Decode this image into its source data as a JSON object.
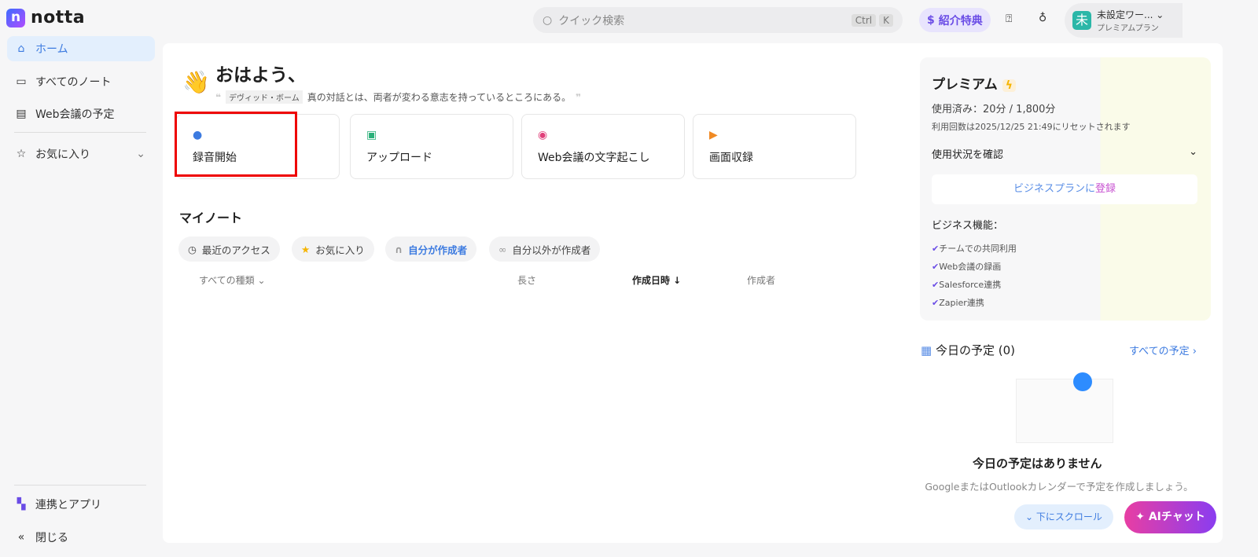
{
  "app": {
    "logo_letter": "n",
    "name": "notta"
  },
  "sidebar": {
    "items": [
      {
        "label": "ホーム",
        "icon": "home-icon"
      },
      {
        "label": "すべてのノート",
        "icon": "folder-icon"
      },
      {
        "label": "Web会議の予定",
        "icon": "calendar-icon"
      },
      {
        "label": "お気に入り",
        "icon": "star-icon"
      }
    ],
    "bottom": [
      {
        "label": "連携とアプリ"
      },
      {
        "label": "閉じる"
      }
    ]
  },
  "header": {
    "search_placeholder": "クイック検索",
    "kbd1": "Ctrl",
    "kbd2": "K",
    "referral": "紹介特典",
    "user_name": "未設定ワー...",
    "user_avatar": "未",
    "user_plan": "プレミアムプラン"
  },
  "greeting": {
    "title": "おはよう、",
    "author": "デヴィッド・ボーム",
    "quote": "真の対話とは、両者が変わる意志を持っているところにある。"
  },
  "actions": [
    {
      "label": "録音開始",
      "color": "#3d7be0"
    },
    {
      "label": "アップロード",
      "color": "#2bb07a"
    },
    {
      "label": "Web会議の文字起こし",
      "color": "#e0407a"
    },
    {
      "label": "画面収録",
      "color": "#f08a24"
    }
  ],
  "notes": {
    "title": "マイノート",
    "filters": [
      "最近のアクセス",
      "お気に入り",
      "自分が作成者",
      "自分以外が作成者"
    ],
    "columns": {
      "type": "すべての種類",
      "length": "長さ",
      "created": "作成日時 ↓",
      "author": "作成者"
    }
  },
  "premium": {
    "title": "プレミアム",
    "usage": "使用済み：20分 / 1,800分",
    "reset": "利用回数は2025/12/25 21:49にリセットされます",
    "check": "使用状況を確認",
    "upgrade_a": "ビジネスプランに",
    "upgrade_b": "登録",
    "features_title": "ビジネス機能：",
    "features": [
      "チームでの共同利用",
      "Web会議の録画",
      "Salesforce連携",
      "Zapier連携"
    ]
  },
  "schedule": {
    "title": "今日の予定 (0)",
    "all": "すべての予定",
    "empty_title": "今日の予定はありません",
    "empty_desc": "GoogleまたはOutlookカレンダーで予定を作成しましょう。"
  },
  "floating": {
    "scroll": "下にスクロール",
    "ai": "AIチャット"
  }
}
